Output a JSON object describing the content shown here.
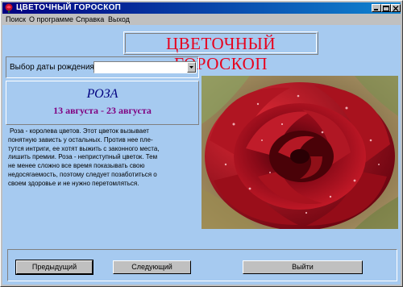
{
  "window": {
    "title": "ЦВЕТОЧНЫЙ ГОРОСКОП"
  },
  "menu": {
    "items": [
      "Поиск",
      "О программе",
      "Справка",
      "Выход"
    ]
  },
  "banner": {
    "title": "ЦВЕТОЧНЫЙ ГОРОСКОП"
  },
  "date_picker": {
    "label": "Выбор даты рождения",
    "value": ""
  },
  "flower": {
    "name": "РОЗА",
    "dates": "13 августа - 23 августа",
    "description_lines": [
      "Роза - королева цветов. Этот цветок вызывает",
      "понятную зависть у остальных. Против нее пле-",
      "тутся интриги, ее хотят выжить с законного места,",
      "лишить премии. Роза - неприступный цветок. Тем",
      "не менее сложно все время показывать свою",
      "недосягаемость, поэтому следует позаботиться о",
      "своем здоровье и не нужно перетомляться."
    ]
  },
  "buttons": {
    "prev": "Предыдущий",
    "next": "Следующий",
    "exit": "Выйти"
  },
  "colors": {
    "title_gradient_start": "#000080",
    "title_gradient_end": "#1084d0",
    "client_bg": "#a6caf0",
    "banner_text": "#e8001c",
    "flower_name": "#000080",
    "flower_dates": "#800080"
  },
  "icons": {
    "app": "rose-icon",
    "minimize": "minimize-icon",
    "maximize": "maximize-icon",
    "close": "close-icon",
    "dropdown": "chevron-down-icon"
  }
}
